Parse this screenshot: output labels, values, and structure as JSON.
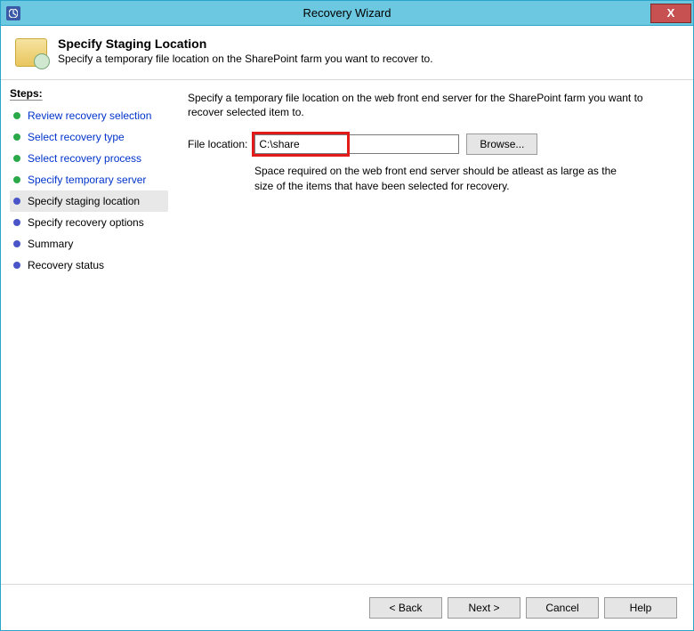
{
  "window": {
    "title": "Recovery Wizard"
  },
  "header": {
    "title": "Specify Staging Location",
    "subtitle": "Specify a temporary file location on the SharePoint farm you want to recover to."
  },
  "sidebar": {
    "title": "Steps:",
    "items": [
      {
        "label": "Review recovery selection",
        "status": "completed"
      },
      {
        "label": "Select recovery type",
        "status": "completed"
      },
      {
        "label": "Select recovery process",
        "status": "completed"
      },
      {
        "label": "Specify temporary server",
        "status": "completed"
      },
      {
        "label": "Specify staging location",
        "status": "current"
      },
      {
        "label": "Specify recovery options",
        "status": "pending"
      },
      {
        "label": "Summary",
        "status": "pending"
      },
      {
        "label": "Recovery status",
        "status": "pending"
      }
    ]
  },
  "main": {
    "instruction": "Specify a temporary file location on the web front end server for the SharePoint farm you want to recover selected item to.",
    "file_location_label": "File location:",
    "file_location_value": "C:\\share",
    "browse_label": "Browse...",
    "space_note": "Space required on the web front end server should be atleast as large as the size of the items that have been selected for recovery."
  },
  "footer": {
    "back": "< Back",
    "next": "Next >",
    "cancel": "Cancel",
    "help": "Help"
  }
}
